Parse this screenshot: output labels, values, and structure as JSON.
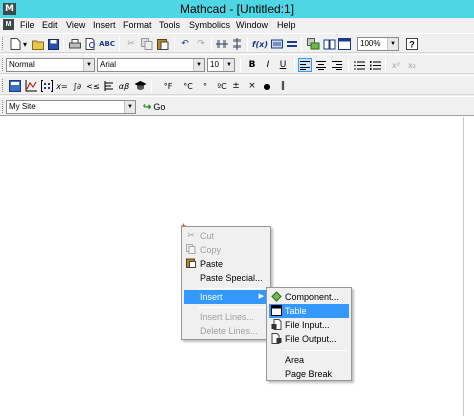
{
  "window": {
    "title": "Mathcad - [Untitled:1]",
    "app_letter": "M"
  },
  "menubar": {
    "items": [
      "File",
      "Edit",
      "View",
      "Insert",
      "Format",
      "Tools",
      "Symbolics",
      "Window",
      "Help"
    ]
  },
  "standard_toolbar": {
    "zoom_value": "100%",
    "buttons": [
      "new",
      "open",
      "save",
      "print",
      "print-preview",
      "spell-check",
      "cut",
      "copy",
      "paste",
      "undo",
      "redo",
      "align-across",
      "align-down",
      "insert-function",
      "insert-unit",
      "calculate",
      "insert-component",
      "resources",
      "resource-center",
      "help"
    ]
  },
  "formatting_toolbar": {
    "style_value": "Normal",
    "font_value": "Arial",
    "size_value": "10",
    "bold_label": "B",
    "italic_label": "I",
    "underline_label": "U",
    "superscript_label": "x²",
    "subscript_label": "x₂"
  },
  "math_toolbar": {
    "symbols": [
      "°F",
      "°C",
      "°",
      "ºC",
      "±",
      "×",
      "●",
      "‖"
    ]
  },
  "web_toolbar": {
    "site_value": "My Site",
    "go_label": "Go"
  },
  "context_menu": {
    "items": [
      {
        "label": "Cut",
        "enabled": false,
        "icon": "scissors-icon"
      },
      {
        "label": "Copy",
        "enabled": false,
        "icon": "copy-icon"
      },
      {
        "label": "Paste",
        "enabled": true,
        "icon": "paste-icon"
      },
      {
        "label": "Paste Special...",
        "enabled": true
      },
      {
        "label": "Insert",
        "enabled": true,
        "highlighted": true,
        "submenu": true
      },
      {
        "label": "Insert Lines...",
        "enabled": false
      },
      {
        "label": "Delete Lines...",
        "enabled": false
      }
    ]
  },
  "submenu": {
    "items": [
      {
        "label": "Component...",
        "icon": "component-icon"
      },
      {
        "label": "Table",
        "icon": "table-icon",
        "highlighted": true
      },
      {
        "label": "File Input...",
        "icon": "file-input-icon"
      },
      {
        "label": "File Output...",
        "icon": "file-output-icon"
      },
      {
        "label": "Area"
      },
      {
        "label": "Page Break"
      }
    ]
  },
  "colors": {
    "titlebar": "#4fd6e4",
    "highlight": "#3399ff",
    "chrome": "#f0f0f0"
  }
}
